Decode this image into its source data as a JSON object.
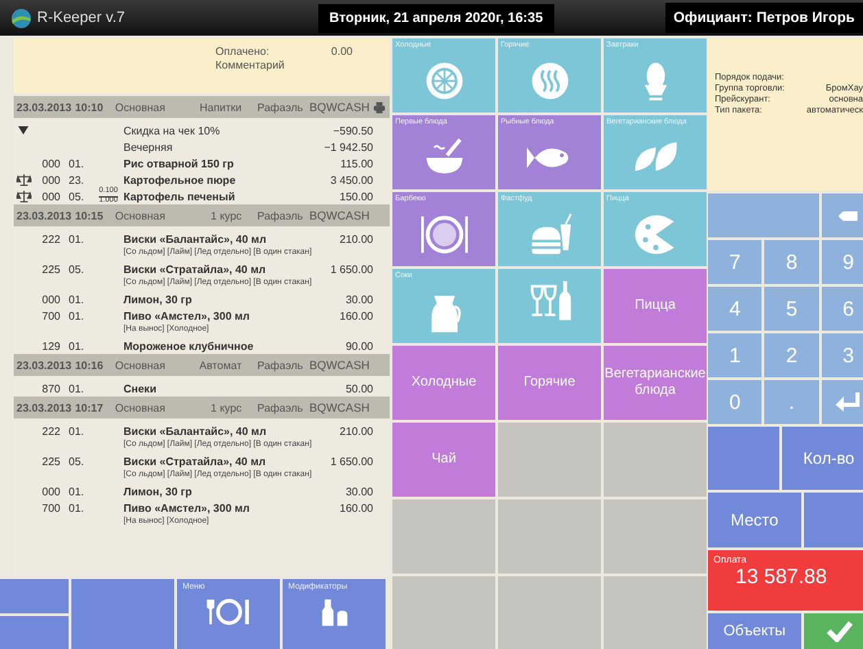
{
  "top_bar": {
    "app_name": "R-Keeper v.7",
    "date": "Вторник, 21 апреля 2020г, 16:35",
    "waiter": "Официант: Петров Игорь"
  },
  "check_info": {
    "paid_label": "Оплачено:",
    "paid_value": "0.00",
    "comment_label": "Комментарий"
  },
  "orders": [
    {
      "date": "23.03.2013",
      "time": "10:10",
      "menu": "Основная",
      "course": "Напитки",
      "waiter": "Рафаэль",
      "station": "BQWCASH",
      "printed": true,
      "items": [
        {
          "kind": "discount",
          "expanded": true,
          "name": "Скидка на чек 10%",
          "price": "−590.50"
        },
        {
          "kind": "discount",
          "expanded": false,
          "name": "Вечерняя",
          "price": "−1 942.50"
        },
        {
          "kind": "dish",
          "weighed": false,
          "code": "000",
          "qty": "01.",
          "name": "Рис отварной 150 гр",
          "price": "115.00"
        },
        {
          "kind": "dish",
          "weighed": true,
          "code": "000",
          "qty": "23.",
          "name": "Картофельное пюре",
          "price": "3 450.00"
        },
        {
          "kind": "dish",
          "weighed": true,
          "code": "000",
          "qty": "05.",
          "weight": "0.100",
          "unit_weight": "1.000",
          "name": "Картофель печеный",
          "price": "150.00"
        }
      ]
    },
    {
      "date": "23.03.2013",
      "time": "10:15",
      "menu": "Основная",
      "course": "1 курс",
      "waiter": "Рафаэль",
      "station": "BQWCASH",
      "printed": false,
      "items": [
        {
          "kind": "dish",
          "weighed": false,
          "code": "222",
          "qty": "01.",
          "name": "Виски «Балантайс», 40 мл",
          "price": "210.00",
          "modifiers": "[Со льдом] [Лайм] [Лед отдельно] [В один стакан]"
        },
        {
          "kind": "dish",
          "weighed": false,
          "code": "225",
          "qty": "05.",
          "name": "Виски «Стратайла», 40 мл",
          "price": "1 650.00",
          "modifiers": "[Со льдом] [Лайм] [Лед отдельно] [В один стакан]"
        },
        {
          "kind": "dish",
          "weighed": false,
          "code": "000",
          "qty": "01.",
          "name": "Лимон, 30 гр",
          "price": "30.00"
        },
        {
          "kind": "dish",
          "weighed": false,
          "code": "700",
          "qty": "01.",
          "name": "Пиво «Амстел», 300 мл",
          "price": "160.00",
          "modifiers": "[На вынос] [Холодное]"
        },
        {
          "kind": "dish",
          "weighed": false,
          "code": "129",
          "qty": "01.",
          "name": "Мороженое клубничное",
          "price": "90.00"
        }
      ]
    },
    {
      "date": "23.03.2013",
      "time": "10:16",
      "menu": "Основная",
      "course": "Автомат",
      "waiter": "Рафаэль",
      "station": "BQWCASH",
      "printed": false,
      "items": [
        {
          "kind": "dish",
          "weighed": false,
          "code": "870",
          "qty": "01.",
          "name": "Снеки",
          "price": "50.00"
        }
      ]
    },
    {
      "date": "23.03.2013",
      "time": "10:17",
      "menu": "Основная",
      "course": "1 курс",
      "waiter": "Рафаэль",
      "station": "BQWCASH",
      "printed": false,
      "items": [
        {
          "kind": "dish",
          "weighed": false,
          "code": "222",
          "qty": "01.",
          "name": "Виски «Балантайс», 40 мл",
          "price": "210.00",
          "modifiers": "[Со льдом] [Лайм] [Лед отдельно] [В один стакан]"
        },
        {
          "kind": "dish",
          "weighed": false,
          "code": "225",
          "qty": "05.",
          "name": "Виски «Стратайла», 40 мл",
          "price": "1 650.00",
          "modifiers": "[Со льдом] [Лайм] [Лед отдельно] [В один стакан]"
        },
        {
          "kind": "dish",
          "weighed": false,
          "code": "000",
          "qty": "01.",
          "name": "Лимон, 30 гр",
          "price": "30.00"
        },
        {
          "kind": "dish",
          "weighed": false,
          "code": "700",
          "qty": "01.",
          "name": "Пиво «Амстел», 300 мл",
          "price": "160.00",
          "modifiers": "[На вынос] [Холодное]"
        }
      ]
    }
  ],
  "bottom_buttons": [
    {
      "kind": "split"
    },
    {
      "kind": "blank"
    },
    {
      "kind": "menu",
      "label": "Меню"
    },
    {
      "kind": "modifiers",
      "label": "Модификаторы"
    }
  ],
  "categories": [
    {
      "kind": "icon",
      "label": "Холодные",
      "color": "#7cc6d8"
    },
    {
      "kind": "icon",
      "label": "Горячие",
      "color": "#7cc6d8"
    },
    {
      "kind": "icon",
      "label": "Завтраки",
      "color": "#7cc6d8"
    },
    {
      "kind": "icon",
      "label": "Первые блюда",
      "color": "#a282d6"
    },
    {
      "kind": "icon",
      "label": "Рыбные блюда",
      "color": "#a282d6"
    },
    {
      "kind": "icon",
      "label": "Вегетарианские блюда",
      "color": "#7cc6d8"
    },
    {
      "kind": "icon",
      "label": "Барбекю",
      "color": "#a282d6"
    },
    {
      "kind": "icon",
      "label": "Фастфуд",
      "color": "#7cc6d8"
    },
    {
      "kind": "icon",
      "label": "Пицца",
      "color": "#7cc6d8"
    },
    {
      "kind": "icon",
      "label": "Соки",
      "color": "#7cc6d8"
    },
    {
      "kind": "icon",
      "color": "#7cc6d8"
    },
    {
      "kind": "text",
      "label": "Пицца",
      "color": "#c17cd9"
    },
    {
      "kind": "text",
      "label": "Холодные",
      "color": "#c17cd9"
    },
    {
      "kind": "text",
      "label": "Горячие",
      "color": "#c17cd9"
    },
    {
      "kind": "text",
      "label": "Вегетарианские блюда",
      "color": "#c17cd9"
    },
    {
      "kind": "text",
      "label": "Чай",
      "color": "#c17cd9"
    },
    {
      "kind": "empty",
      "color": "#c5c4bf"
    },
    {
      "kind": "empty",
      "color": "#c5c4bf"
    },
    {
      "kind": "empty",
      "color": "#c5c4bf"
    },
    {
      "kind": "empty",
      "color": "#c5c4bf"
    },
    {
      "kind": "empty",
      "color": "#c5c4bf"
    },
    {
      "kind": "empty",
      "color": "#c5c4bf"
    },
    {
      "kind": "empty",
      "color": "#c5c4bf"
    },
    {
      "kind": "empty",
      "color": "#c5c4bf"
    }
  ],
  "check_details": [
    {
      "label": "Порядок подачи:"
    },
    {
      "label": "Группа торговли:",
      "value": "БромХау"
    },
    {
      "label": "Прейскурант:",
      "value": "основна"
    },
    {
      "label": "Тип пакета:",
      "value": "автоматическ"
    }
  ],
  "keypad": [
    {
      "kind": "blank_wide"
    },
    {
      "kind": "backspace"
    },
    {
      "kind": "digit",
      "label": "7"
    },
    {
      "kind": "digit",
      "label": "8"
    },
    {
      "kind": "digit",
      "label": "9"
    },
    {
      "kind": "digit",
      "label": "4"
    },
    {
      "kind": "digit",
      "label": "5"
    },
    {
      "kind": "digit",
      "label": "6"
    },
    {
      "kind": "digit",
      "label": "1"
    },
    {
      "kind": "digit",
      "label": "2"
    },
    {
      "kind": "digit",
      "label": "3"
    },
    {
      "kind": "digit",
      "label": "0"
    },
    {
      "kind": "digit",
      "label": "."
    },
    {
      "kind": "enter"
    }
  ],
  "actions": {
    "quantity": "Кол-во",
    "seat": "Место",
    "payment_label": "Оплата",
    "payment_amount": "13 587.88",
    "objects": "Объекты"
  }
}
